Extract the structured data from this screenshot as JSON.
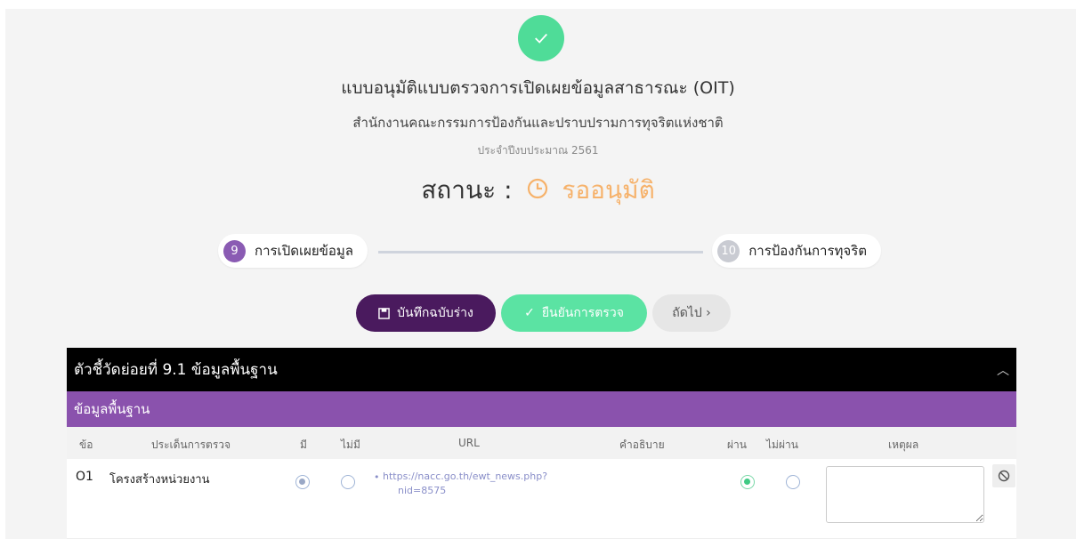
{
  "header": {
    "title": "แบบอนุมัติแบบตรวจการเปิดเผยข้อมูลสาธารณะ (OIT)",
    "organization": "สำนักงานคณะกรรมการป้องกันและปราบปรามการทุจริตแห่งชาติ",
    "fiscal_year": "ประจำปีงบประมาณ 2561",
    "status_label": "สถานะ :",
    "status_value": "รออนุมัติ"
  },
  "stepper": {
    "steps": [
      {
        "number": "9",
        "label": "การเปิดเผยข้อมูล"
      },
      {
        "number": "10",
        "label": "การป้องกันการทุจริต"
      }
    ]
  },
  "actions": {
    "save_draft": "บันทึกฉบับร่าง",
    "confirm": "ยืนยันการตรวจ",
    "next": "ถัดไป ›"
  },
  "panel": {
    "title": "ตัวชี้วัดย่อยที่ 9.1 ข้อมูลพื้นฐาน",
    "section": "ข้อมูลพื้นฐาน",
    "columns": [
      "ข้อ",
      "ประเด็นการตรวจ",
      "มี",
      "ไม่มี",
      "URL",
      "คำอธิบาย",
      "ผ่าน",
      "ไม่ผ่าน",
      "เหตุผล"
    ],
    "rows": [
      {
        "no": "O1",
        "issue": "โครงสร้างหน่วยงาน",
        "has": true,
        "url_line1": "https://nacc.go.th/ewt_news.php?",
        "url_line2": "nid=8575",
        "pass": true,
        "reason": ""
      }
    ]
  },
  "colors": {
    "success": "#4fdc98",
    "pending": "#f6b26b",
    "purple": "#8a52ad",
    "draft_button": "#4a1a5e"
  }
}
